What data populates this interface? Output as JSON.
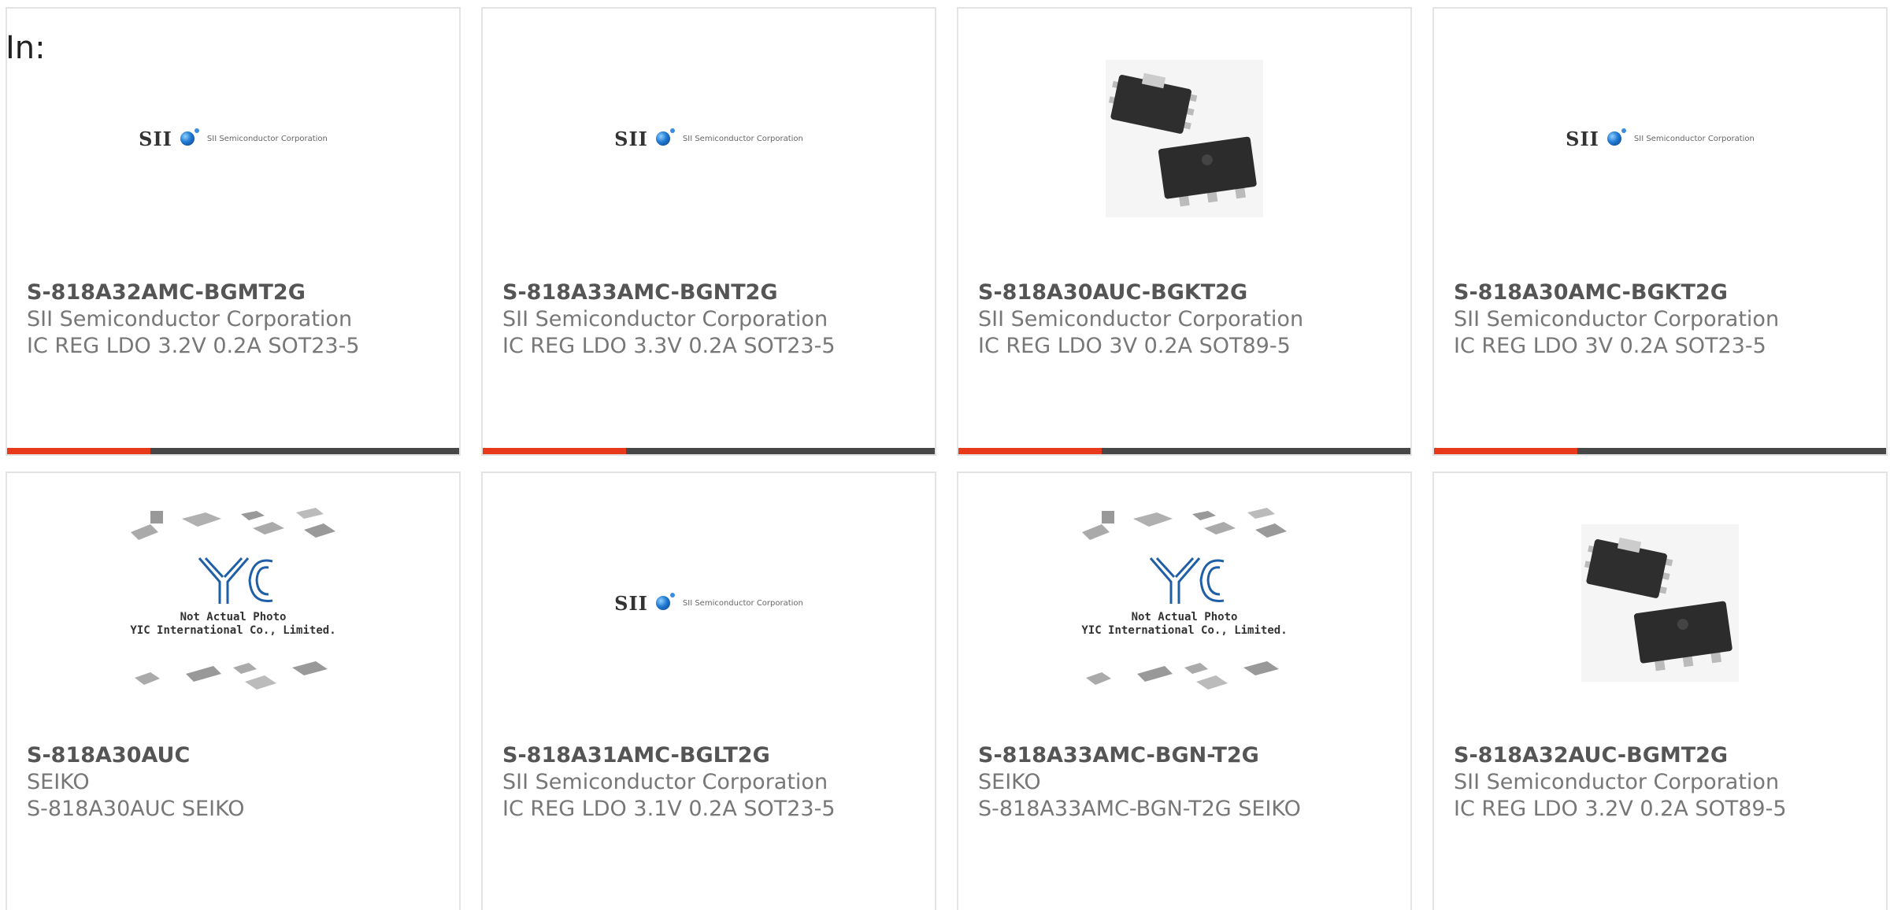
{
  "heading": "In:",
  "accent_colors": {
    "highlight": "#e8391a",
    "bar": "#474747"
  },
  "products": [
    {
      "part_number": "S-818A32AMC-BGMT2G",
      "manufacturer": "SII Semiconductor Corporation",
      "description": "IC REG LDO 3.2V 0.2A SOT23-5",
      "image": "sii-logo"
    },
    {
      "part_number": "S-818A33AMC-BGNT2G",
      "manufacturer": "SII Semiconductor Corporation",
      "description": "IC REG LDO 3.3V 0.2A SOT23-5",
      "image": "sii-logo"
    },
    {
      "part_number": "S-818A30AUC-BGKT2G",
      "manufacturer": "SII Semiconductor Corporation",
      "description": "IC REG LDO 3V 0.2A SOT89-5",
      "image": "chip-photo"
    },
    {
      "part_number": "S-818A30AMC-BGKT2G",
      "manufacturer": "SII Semiconductor Corporation",
      "description": "IC REG LDO 3V 0.2A SOT23-5",
      "image": "sii-logo"
    },
    {
      "part_number": "S-818A30AUC",
      "manufacturer": "SEIKO",
      "description": "S-818A30AUC SEIKO",
      "image": "placeholder-photo"
    },
    {
      "part_number": "S-818A31AMC-BGLT2G",
      "manufacturer": "SII Semiconductor Corporation",
      "description": "IC REG LDO 3.1V 0.2A SOT23-5",
      "image": "sii-logo"
    },
    {
      "part_number": "S-818A33AMC-BGN-T2G",
      "manufacturer": "SEIKO",
      "description": "S-818A33AMC-BGN-T2G SEIKO",
      "image": "placeholder-photo"
    },
    {
      "part_number": "S-818A32AUC-BGMT2G",
      "manufacturer": "SII Semiconductor Corporation",
      "description": "IC REG LDO 3.2V 0.2A SOT89-5",
      "image": "chip-photo"
    }
  ],
  "logo": {
    "brand": "SII",
    "company": "SII Semiconductor Corporation"
  },
  "placeholder": {
    "line1": "Not Actual Photo",
    "line2": "YIC International Co., Limited."
  }
}
